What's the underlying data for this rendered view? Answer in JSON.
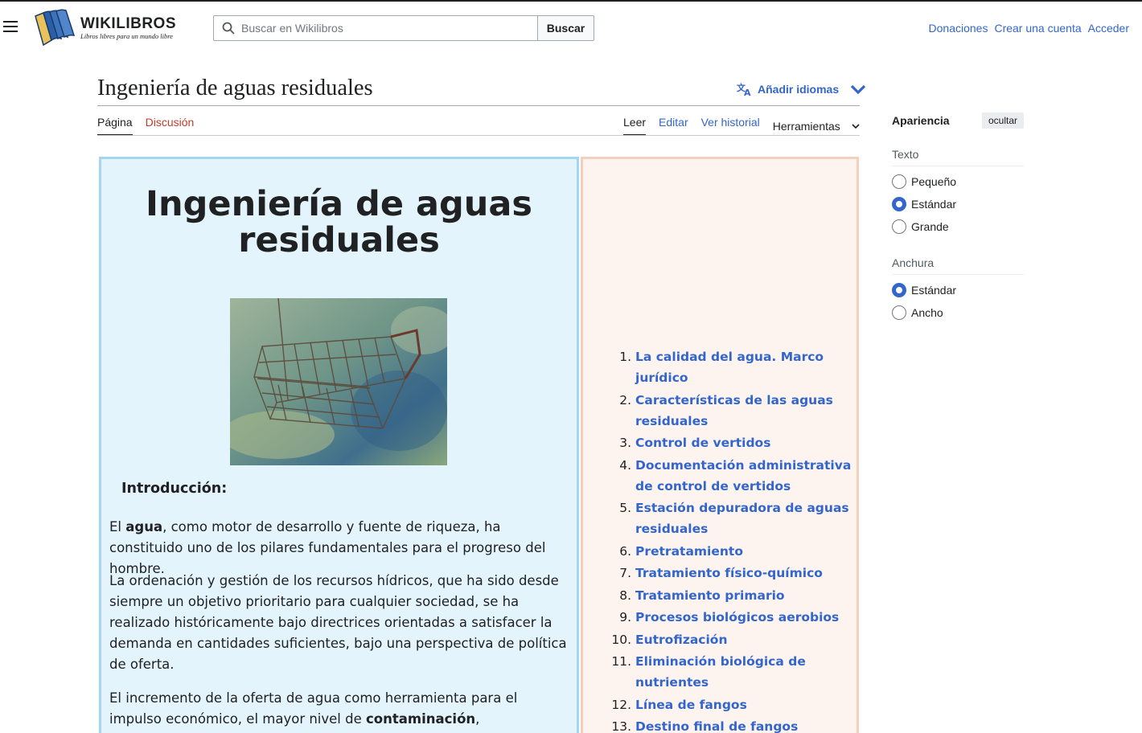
{
  "header": {
    "logo_title": "WIKILIBROS",
    "logo_tagline": "Libros libres para un mundo libre",
    "search_placeholder": "Buscar en Wikilibros",
    "search_button": "Buscar",
    "user_links": [
      "Donaciones",
      "Crear una cuenta",
      "Acceder"
    ]
  },
  "page": {
    "title": "Ingeniería de aguas residuales",
    "languages_button": "Añadir idiomas",
    "tabs_left": [
      "Página",
      "Discusión"
    ],
    "tabs_right": [
      "Leer",
      "Editar",
      "Ver historial"
    ],
    "tools_label": "Herramientas"
  },
  "book": {
    "title": "Ingeniería de aguas residuales",
    "intro_heading": "Introducción:",
    "paragraphs": [
      [
        "El ",
        "agua",
        ", como motor de desarrollo y fuente de riqueza, ha constituido uno de los pilares fundamentales para el progreso del hombre."
      ],
      [
        "La ordenación y gestión de los recursos hídricos, que ha sido desde siempre un objetivo prioritario para cualquier sociedad, se ha realizado históricamente bajo directrices orientadas a satisfacer la demanda en cantidades suficientes, bajo una perspectiva de política de oferta."
      ],
      [
        "El incremento de la oferta de agua como herramienta para el impulso económico, el mayor nivel de ",
        "contaminación",
        ", irremisiblemente"
      ]
    ]
  },
  "toc": [
    {
      "n": "1.",
      "label": "La calidad del agua. Marco jurídico"
    },
    {
      "n": "2.",
      "label": "Características de las aguas residuales"
    },
    {
      "n": "3.",
      "label": "Control de vertidos"
    },
    {
      "n": "4.",
      "label": "Documentación administrativa de control de vertidos"
    },
    {
      "n": "5.",
      "label": "Estación depuradora de aguas residuales"
    },
    {
      "n": "6.",
      "label": "Pretratamiento"
    },
    {
      "n": "7.",
      "label": "Tratamiento físico-químico"
    },
    {
      "n": "8.",
      "label": "Tratamiento primario"
    },
    {
      "n": "9.",
      "label": "Procesos biológicos aerobios"
    },
    {
      "n": "10.",
      "label": "Eutrofización"
    },
    {
      "n": "11.",
      "label": "Eliminación biológica de nutrientes"
    },
    {
      "n": "12.",
      "label": "Línea de fangos"
    },
    {
      "n": "13.",
      "label": "Destino final de fangos"
    }
  ],
  "appearance": {
    "title": "Apariencia",
    "hide": "ocultar",
    "text_label": "Texto",
    "text_options": [
      "Pequeño",
      "Estándar",
      "Grande"
    ],
    "text_selected": 1,
    "width_label": "Anchura",
    "width_options": [
      "Estándar",
      "Ancho"
    ],
    "width_selected": 0
  },
  "colors": {
    "link": "#3366cc",
    "red_link": "#bf3c2c",
    "left_box_bg": "#e4f4fd",
    "right_box_bg": "#fef4ef"
  }
}
